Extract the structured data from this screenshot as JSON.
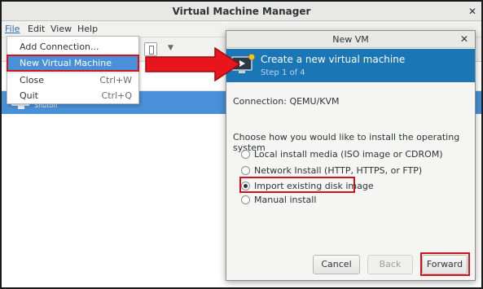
{
  "window": {
    "title": "Virtual Machine Manager",
    "close_glyph": "✕"
  },
  "menubar": {
    "file": "File",
    "edit": "Edit",
    "view": "View",
    "help": "Help"
  },
  "file_menu": {
    "items": [
      {
        "label": "Add Connection...",
        "accel": ""
      },
      {
        "label": "New Virtual Machine",
        "accel": ""
      },
      {
        "label": "Close",
        "accel": "Ctrl+W"
      },
      {
        "label": "Quit",
        "accel": "Ctrl+Q"
      }
    ]
  },
  "vm_list": {
    "rows": [
      {
        "status": "Shutoff"
      }
    ]
  },
  "dialog": {
    "title": "New VM",
    "close_glyph": "✕",
    "banner_title": "Create a new virtual machine",
    "banner_step": "Step 1 of 4",
    "connection": "Connection:  QEMU/KVM",
    "prompt": "Choose how you would like to install the operating system",
    "options": [
      {
        "label": "Local install media (ISO image or CDROM)",
        "selected": false
      },
      {
        "label": "Network Install (HTTP, HTTPS, or FTP)",
        "selected": false
      },
      {
        "label": "Import existing disk image",
        "selected": true
      },
      {
        "label": "Manual install",
        "selected": false
      }
    ],
    "buttons": {
      "cancel": "Cancel",
      "back": "Back",
      "forward": "Forward"
    }
  },
  "colors": {
    "highlight_blue": "#4a90d9",
    "banner_blue": "#1a76b5",
    "annotation_red": "#d0141b"
  },
  "icons": [
    "close-icon",
    "vm-monitor-icon",
    "new-vm-wizard-icon",
    "dropdown-caret-icon",
    "red-arrow-annotation"
  ]
}
